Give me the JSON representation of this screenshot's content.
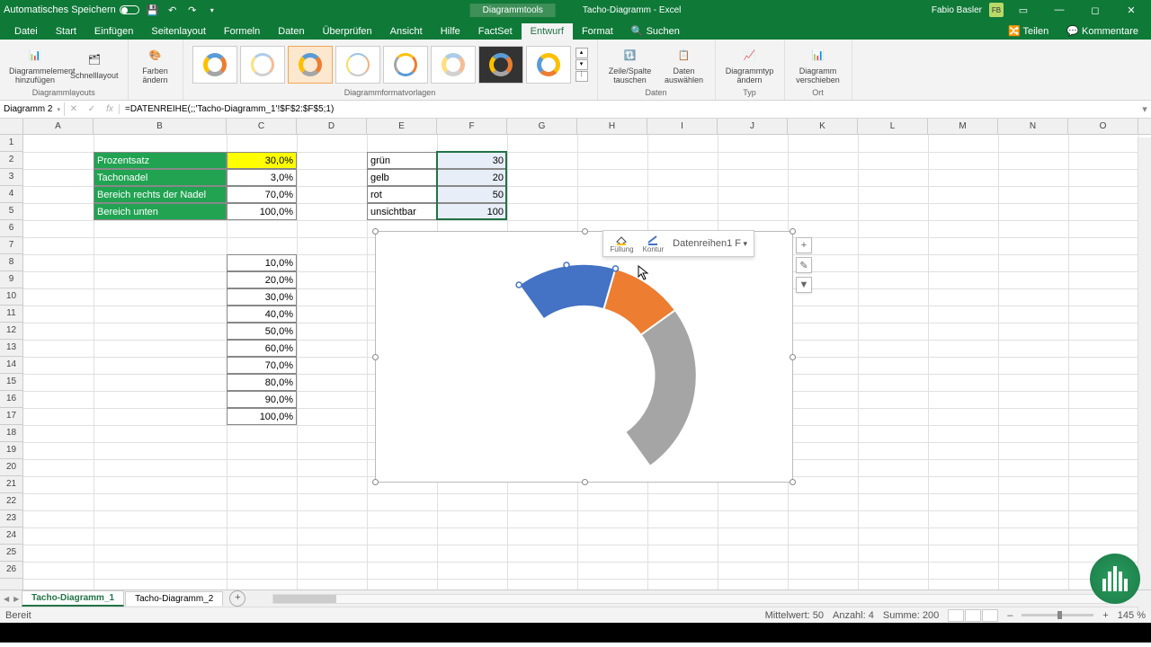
{
  "titlebar": {
    "autosave": "Automatisches Speichern",
    "chart_tools": "Diagrammtools",
    "doc": "Tacho-Diagramm - Excel",
    "user": "Fabio Basler",
    "user_initials": "FB"
  },
  "tabs": {
    "datei": "Datei",
    "start": "Start",
    "einfuegen": "Einfügen",
    "seitenlayout": "Seitenlayout",
    "formeln": "Formeln",
    "daten": "Daten",
    "ueberpruefen": "Überprüfen",
    "ansicht": "Ansicht",
    "hilfe": "Hilfe",
    "factset": "FactSet",
    "entwurf": "Entwurf",
    "format": "Format",
    "suchen": "Suchen",
    "teilen": "Teilen",
    "kommentare": "Kommentare"
  },
  "ribbon": {
    "layouts": {
      "add_elem": "Diagrammelement hinzufügen",
      "quick": "Schnelllayout",
      "group": "Diagrammlayouts"
    },
    "colors": {
      "btn": "Farben ändern"
    },
    "styles_group": "Diagrammformatvorlagen",
    "data": {
      "switch": "Zeile/Spalte tauschen",
      "select": "Daten auswählen",
      "group": "Daten"
    },
    "type": {
      "btn": "Diagrammtyp ändern",
      "group": "Typ"
    },
    "location": {
      "btn": "Diagramm verschieben",
      "group": "Ort"
    }
  },
  "namebox": "Diagramm 2",
  "formula": "=DATENREIHE(;;'Tacho-Diagramm_1'!$F$2:$F$5;1)",
  "cols": [
    "A",
    "B",
    "C",
    "D",
    "E",
    "F",
    "G",
    "H",
    "I",
    "J",
    "K",
    "L",
    "M",
    "N",
    "O"
  ],
  "table1": {
    "rows": [
      {
        "label": "Prozentsatz",
        "value": "30,0%"
      },
      {
        "label": "Tachonadel",
        "value": "3,0%"
      },
      {
        "label": "Bereich rechts der Nadel",
        "value": "70,0%"
      },
      {
        "label": "Bereich unten",
        "value": "100,0%"
      }
    ]
  },
  "table2": {
    "rows": [
      {
        "label": "grün",
        "value": "30"
      },
      {
        "label": "gelb",
        "value": "20"
      },
      {
        "label": "rot",
        "value": "50"
      },
      {
        "label": "unsichtbar",
        "value": "100"
      }
    ]
  },
  "list": [
    "10,0%",
    "20,0%",
    "30,0%",
    "40,0%",
    "50,0%",
    "60,0%",
    "70,0%",
    "80,0%",
    "90,0%",
    "100,0%"
  ],
  "chart_data": {
    "type": "pie",
    "variant": "doughnut",
    "categories": [
      "grün",
      "gelb",
      "rot",
      "unsichtbar"
    ],
    "values": [
      30,
      20,
      50,
      100
    ],
    "colors": [
      "#4472c4",
      "#ed7d31",
      "#a5a5a5",
      "transparent"
    ],
    "rotation_deg": 270,
    "hole": 0.62,
    "title": "",
    "legend": false
  },
  "minibar": {
    "fill": "Füllung",
    "outline": "Kontur",
    "series": "Datenreihen1 F"
  },
  "sheets": {
    "s1": "Tacho-Diagramm_1",
    "s2": "Tacho-Diagramm_2"
  },
  "status": {
    "ready": "Bereit",
    "mean": "Mittelwert: 50",
    "count": "Anzahl: 4",
    "sum": "Summe: 200",
    "zoom": "145 %"
  }
}
